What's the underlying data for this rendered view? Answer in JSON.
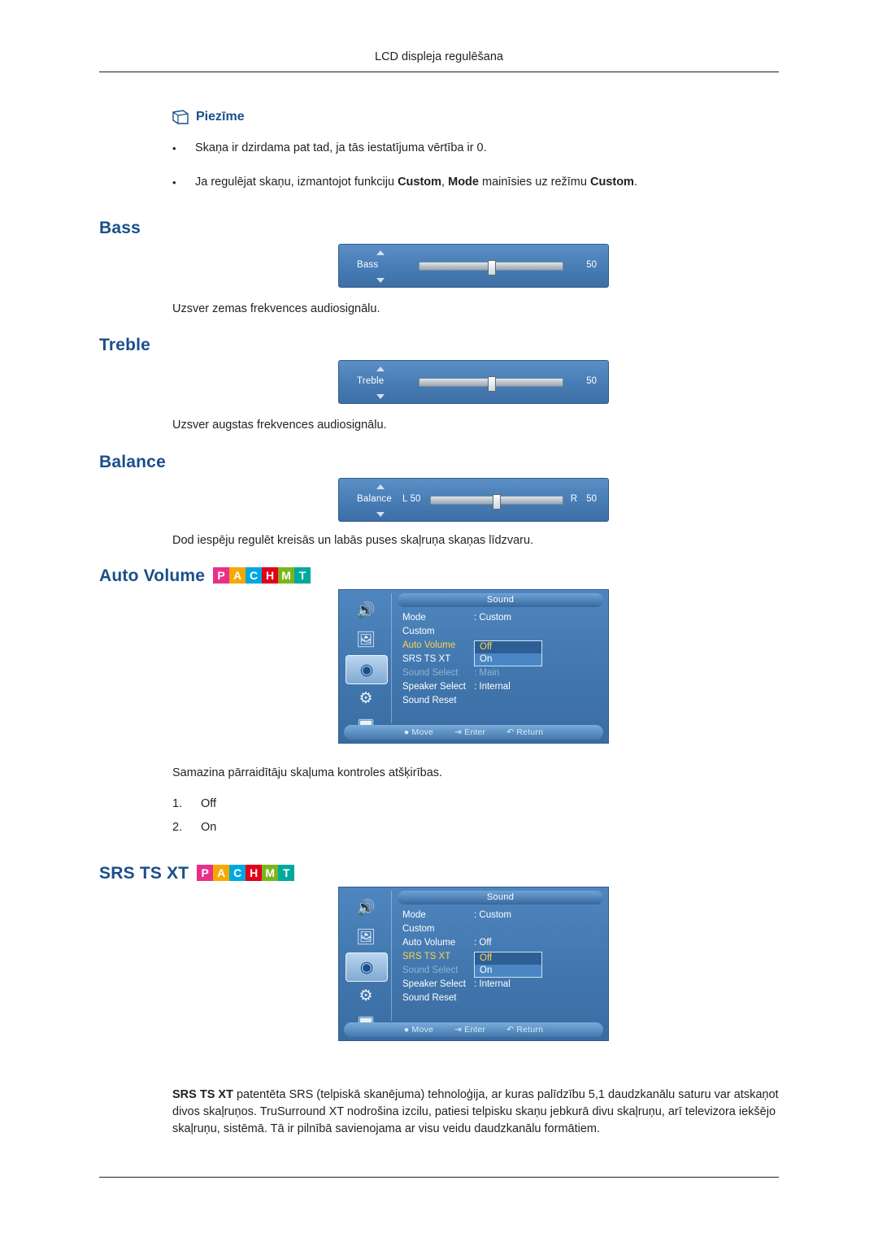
{
  "header": {
    "title": "LCD displeja regulēšana"
  },
  "note": {
    "icon": "note-icon",
    "title": "Piezīme",
    "items": [
      {
        "bullet": "•",
        "text": "Skaņa ir dzirdama pat tad, ja tās iestatījuma vērtība ir 0."
      },
      {
        "bullet": "•",
        "text_pre": "Ja regulējat skaņu, izmantojot funkciju ",
        "b1": "Custom",
        "mid1": ", ",
        "b2": "Mode",
        "mid2": " mainīsies uz režīmu ",
        "b3": "Custom",
        "text_post": "."
      }
    ]
  },
  "badges": {
    "letters": [
      "P",
      "A",
      "C",
      "H",
      "M",
      "T"
    ],
    "colors": [
      "#e8308a",
      "#f6a800",
      "#00a8e1",
      "#e2001a",
      "#7ab51d",
      "#00a99d"
    ]
  },
  "sections": {
    "bass": {
      "heading": "Bass",
      "description": "Uzsver zemas frekvences audiosignālu.",
      "osd": {
        "label": "Bass",
        "value": "50",
        "knob_pct": 50
      }
    },
    "treble": {
      "heading": "Treble",
      "description": "Uzsver augstas frekvences audiosignālu.",
      "osd": {
        "label": "Treble",
        "value": "50",
        "knob_pct": 50
      }
    },
    "balance": {
      "heading": "Balance",
      "description": "Dod iespēju regulēt kreisās un labās puses skaļruņa skaņas līdzvaru.",
      "osd": {
        "label": "Balance",
        "left_label": "L",
        "left_value": "50",
        "right_label": "R",
        "right_value": "50",
        "knob_pct": 50
      }
    },
    "auto_volume": {
      "heading": "Auto Volume",
      "description": "Samazina pārraidītāju skaļuma kontroles atšķirības.",
      "options": [
        {
          "num": "1.",
          "label": "Off"
        },
        {
          "num": "2.",
          "label": "On"
        }
      ],
      "osd": {
        "title": "Sound",
        "rows": [
          {
            "key": "Mode",
            "value": ": Custom",
            "state": "normal"
          },
          {
            "key": "Custom",
            "value": "",
            "state": "normal"
          },
          {
            "key": "Auto Volume",
            "value": "",
            "state": "highlight"
          },
          {
            "key": "SRS TS XT",
            "value": "",
            "state": "normal"
          },
          {
            "key": "Sound Select",
            "value": ": Main",
            "state": "dim"
          },
          {
            "key": "Speaker Select",
            "value": ": Internal",
            "state": "normal"
          },
          {
            "key": "Sound Reset",
            "value": "",
            "state": "normal"
          }
        ],
        "popup": {
          "selected": "Off",
          "options": [
            "Off",
            "On"
          ]
        },
        "footer": [
          "Move",
          "Enter",
          "Return"
        ],
        "icons": [
          "speaker-icon",
          "picture-icon",
          "sound-icon",
          "setup-icon",
          "multi-control-icon"
        ],
        "selected_icon_index": 2
      }
    },
    "srs_ts_xt": {
      "heading": "SRS TS XT",
      "osd": {
        "title": "Sound",
        "rows": [
          {
            "key": "Mode",
            "value": ": Custom",
            "state": "normal"
          },
          {
            "key": "Custom",
            "value": "",
            "state": "normal"
          },
          {
            "key": "Auto Volume",
            "value": ": Off",
            "state": "normal"
          },
          {
            "key": "SRS TS XT",
            "value": "",
            "state": "highlight"
          },
          {
            "key": "Sound Select",
            "value": "",
            "state": "dim"
          },
          {
            "key": "Speaker Select",
            "value": ": Internal",
            "state": "normal"
          },
          {
            "key": "Sound Reset",
            "value": "",
            "state": "normal"
          }
        ],
        "popup": {
          "selected": "Off",
          "options": [
            "Off",
            "On"
          ]
        },
        "footer": [
          "Move",
          "Enter",
          "Return"
        ],
        "icons": [
          "speaker-icon",
          "picture-icon",
          "sound-icon",
          "setup-icon",
          "multi-control-icon"
        ],
        "selected_icon_index": 2
      },
      "description_bold": "SRS TS XT",
      "description": " patentēta SRS (telpiskā skanējuma) tehnoloģija, ar kuras palīdzību 5,1 daudzkanālu saturu var atskaņot divos skaļruņos. TruSurround XT nodrošina izcilu, patiesi telpisku skaņu jebkurā divu skaļruņu, arī televizora iekšējo skaļruņu, sistēmā. Tā ir pilnībā savienojama ar visu veidu daudzkanālu formātiem."
    }
  }
}
